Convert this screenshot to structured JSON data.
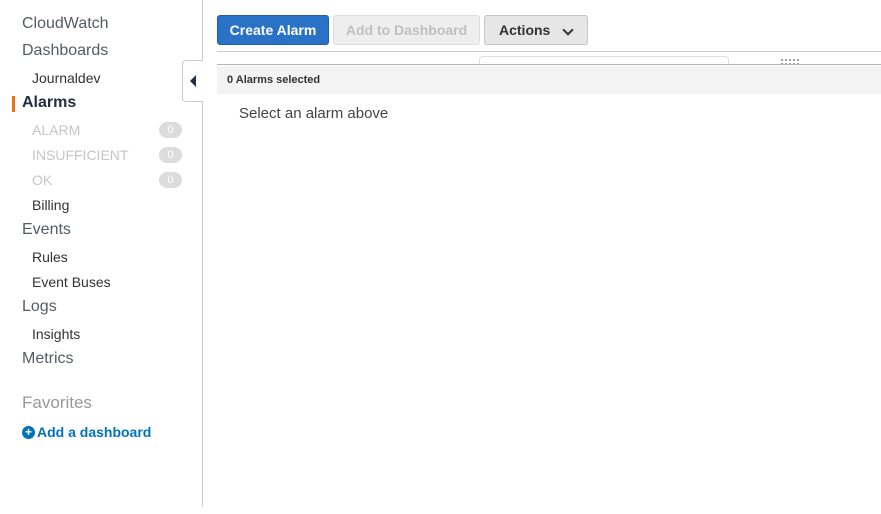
{
  "sidebar": {
    "title": "CloudWatch",
    "dashboards": {
      "label": "Dashboards",
      "items": [
        {
          "label": "Journaldev"
        }
      ]
    },
    "alarms": {
      "label": "Alarms",
      "states": [
        {
          "label": "ALARM",
          "count": "0"
        },
        {
          "label": "INSUFFICIENT",
          "count": "0"
        },
        {
          "label": "OK",
          "count": "0"
        }
      ],
      "items": [
        {
          "label": "Billing"
        }
      ]
    },
    "events": {
      "label": "Events",
      "items": [
        {
          "label": "Rules"
        },
        {
          "label": "Event Buses"
        }
      ]
    },
    "logs": {
      "label": "Logs",
      "items": [
        {
          "label": "Insights"
        }
      ]
    },
    "metrics": {
      "label": "Metrics"
    },
    "favorites": {
      "label": "Favorites",
      "add_label": "Add a dashboard"
    }
  },
  "toolbar": {
    "create_label": "Create Alarm",
    "add_to_dashboard_label": "Add to Dashboard",
    "actions_label": "Actions"
  },
  "selection": {
    "text": "0 Alarms selected"
  },
  "detail": {
    "empty_message": "Select an alarm above"
  },
  "colors": {
    "accent": "#ec7211",
    "primary_button": "#2a72c6",
    "link": "#0073bb"
  }
}
